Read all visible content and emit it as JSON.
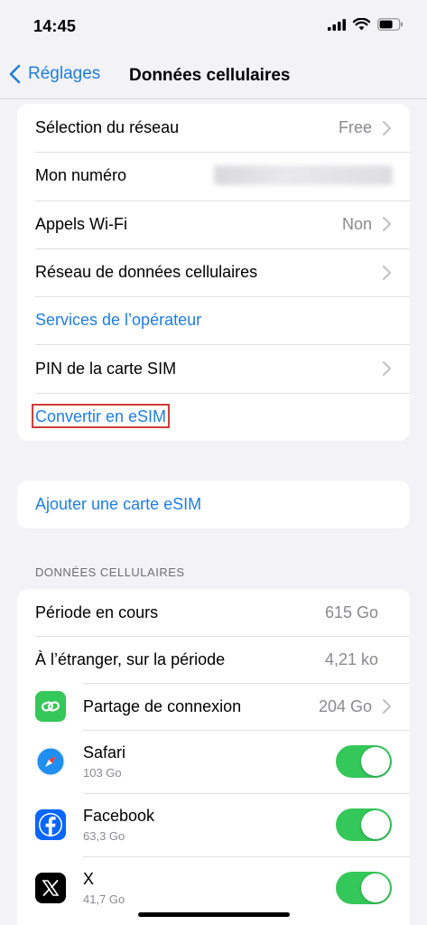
{
  "status_bar": {
    "time": "14:45",
    "icons": [
      "signal-icon",
      "wifi-icon",
      "battery-icon"
    ]
  },
  "nav": {
    "back_label": "Réglages",
    "title": "Données cellulaires"
  },
  "group1": {
    "rows": [
      {
        "label": "Sélection du réseau",
        "value": "Free"
      },
      {
        "label": "Mon numéro",
        "value": ""
      },
      {
        "label": "Appels Wi-Fi",
        "value": "Non"
      },
      {
        "label": "Réseau de données cellulaires",
        "value": ""
      },
      {
        "label": "Services de l’opérateur"
      },
      {
        "label": "PIN de la carte SIM"
      },
      {
        "label": "Convertir en eSIM"
      }
    ]
  },
  "group2": {
    "add_esim": "Ajouter une carte eSIM"
  },
  "cellular": {
    "header": "DONNÉES CELLULAIRES",
    "period_label": "Période en cours",
    "period_value": "615 Go",
    "roaming_label": "À l’étranger, sur la période",
    "roaming_value": "4,21 ko",
    "apps": [
      {
        "name": "Partage de connexion",
        "value": "204 Go",
        "icon": "link-icon",
        "color": "#34c759"
      },
      {
        "name": "Safari",
        "usage": "103 Go",
        "icon": "safari-icon",
        "enabled": true
      },
      {
        "name": "Facebook",
        "usage": "63,3 Go",
        "icon": "facebook-icon",
        "enabled": true
      },
      {
        "name": "X",
        "usage": "41,7 Go",
        "icon": "x-icon",
        "enabled": true
      }
    ]
  },
  "colors": {
    "accent": "#1f7ee0",
    "toggle_on": "#34c759",
    "highlight": "#d23b3b",
    "background": "#f2f2f7"
  }
}
